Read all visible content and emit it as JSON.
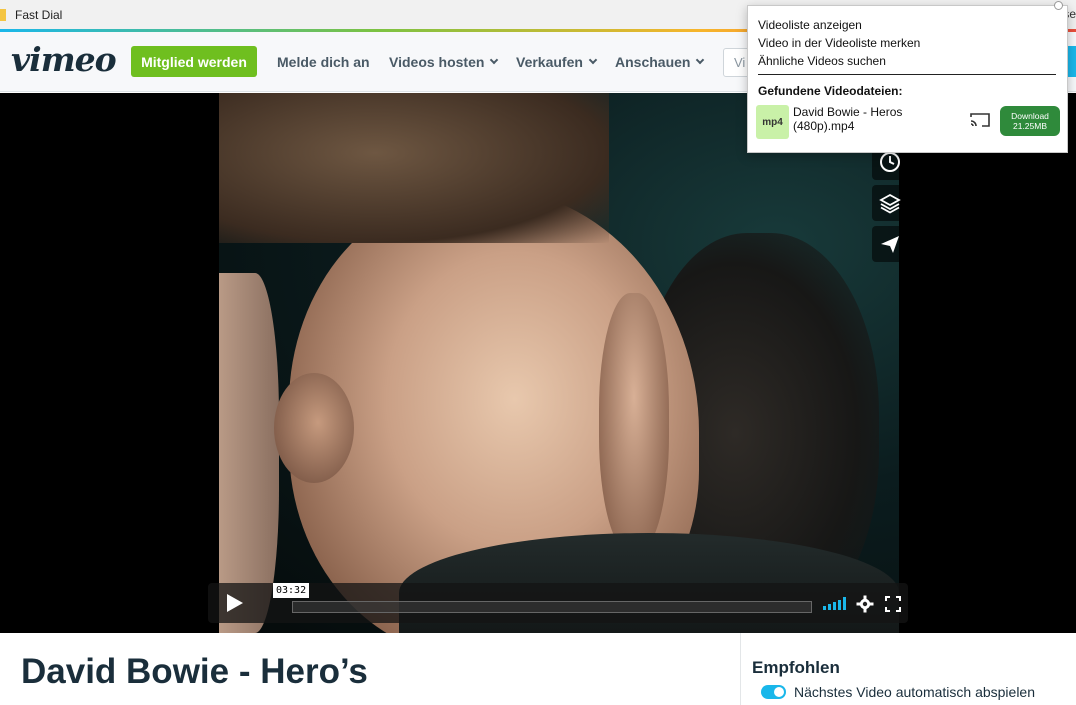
{
  "browser": {
    "bookmark_label": "Fast Dial",
    "right_edge_text": "se"
  },
  "header": {
    "logo": "vimeo",
    "join_button": "Mitglied werden",
    "nav": [
      {
        "label": "Melde dich an"
      },
      {
        "label": "Videos hosten"
      },
      {
        "label": "Verkaufen"
      },
      {
        "label": "Anschauen"
      }
    ],
    "search_placeholder": "Vi"
  },
  "player": {
    "current_time": "03:32",
    "volume_level": 1.0
  },
  "page": {
    "title": "David Bowie - Hero’s"
  },
  "sidebar": {
    "recommended_title": "Empfohlen",
    "autoplay_label": "Nächstes Video automatisch abspielen",
    "autoplay_enabled": true
  },
  "extension_popup": {
    "menu": [
      "Videoliste anzeigen",
      "Video in der Videoliste merken",
      "Ähnliche Videos suchen"
    ],
    "found_heading": "Gefundene Videodateien:",
    "file": {
      "format": "mp4",
      "name": "David Bowie - Heros (480p).mp4",
      "download_label": "Download",
      "download_size": "21.25MB"
    }
  },
  "colors": {
    "accent_green": "#6fbf1f",
    "vimeo_blue": "#1ab7ea",
    "download_green": "#2f8a3b"
  }
}
